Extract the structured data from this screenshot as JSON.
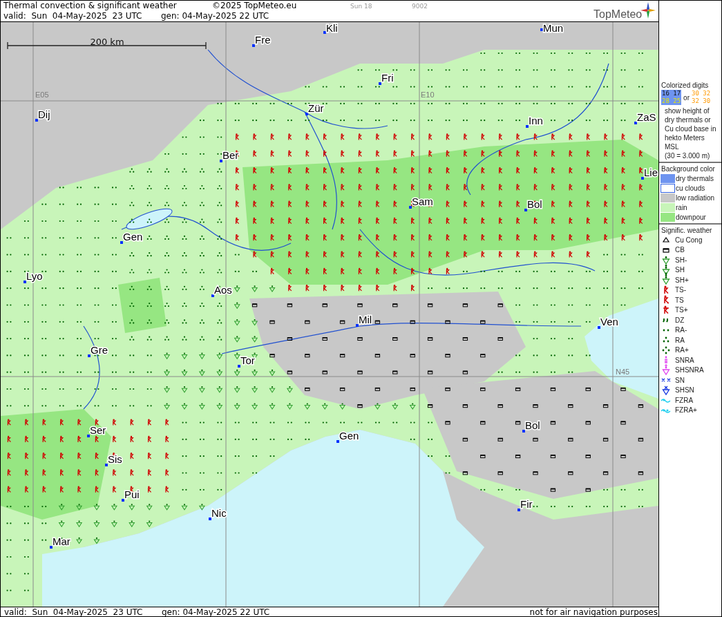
{
  "header": {
    "title": "Thermal convection & significant weather",
    "copyright": "©2025 TopMeteo.eu",
    "run": "Sun 18",
    "code": "9002",
    "valid": "valid:  Sun  04-May-2025  23 UTC",
    "generated": "gen: 04-May-2025 22 UTC",
    "logo": "TopMeteo"
  },
  "map": {
    "scale": "200 km",
    "grid_labels": [
      "E05",
      "E10",
      "N45"
    ],
    "cities": [
      "Kli",
      "Mun",
      "Fre",
      "Fri",
      "Dij",
      "Zür",
      "Inn",
      "ZaS",
      "Ber",
      "Lie",
      "Sam",
      "Bol",
      "Gen",
      "Lyo",
      "Aos",
      "Mil",
      "Ven",
      "Gre",
      "Tor",
      "Ser",
      "Gen",
      "Bol",
      "Sis",
      "Pui",
      "Fir",
      "Nic",
      "Mar"
    ]
  },
  "legend": {
    "digits_title": "Colorized digits",
    "dry_sample": {
      "top": "16 17",
      "bottom": "28 25"
    },
    "or": "or",
    "cu_sample": {
      "top": "30 32",
      "bottom": "32 30"
    },
    "note": "show height of dry thermals or Cu cloud base in hekto Meters MSL",
    "example": "(30 = 3.000 m)",
    "background_title": "Background color",
    "background": [
      {
        "label": "dry thermals",
        "color": "#6e94f0"
      },
      {
        "label": "cu clouds",
        "color": "#ffffff"
      },
      {
        "label": "low radiation",
        "color": "#c8c8c8"
      },
      {
        "label": "rain",
        "color": "#c8f5b9"
      },
      {
        "label": "downpour",
        "color": "#96e682"
      }
    ],
    "weather_title": "Signific. weather",
    "weather": [
      {
        "label": "Cu Cong",
        "kind": "cu_cong"
      },
      {
        "label": "CB",
        "kind": "cb"
      },
      {
        "label": "SH-",
        "kind": "sh_light"
      },
      {
        "label": "SH",
        "kind": "sh"
      },
      {
        "label": "SH+",
        "kind": "sh_heavy"
      },
      {
        "label": "TS-",
        "kind": "ts_light"
      },
      {
        "label": "TS",
        "kind": "ts"
      },
      {
        "label": "TS+",
        "kind": "ts_heavy"
      },
      {
        "label": "DZ",
        "kind": "dz"
      },
      {
        "label": "RA-",
        "kind": "ra_light"
      },
      {
        "label": "RA",
        "kind": "ra"
      },
      {
        "label": "RA+",
        "kind": "ra_heavy"
      },
      {
        "label": "SNRA",
        "kind": "snra"
      },
      {
        "label": "SHSNRA",
        "kind": "shsnra"
      },
      {
        "label": "SN",
        "kind": "sn"
      },
      {
        "label": "SHSN",
        "kind": "shsn"
      },
      {
        "label": "FZRA",
        "kind": "fzra"
      },
      {
        "label": "FZRA+",
        "kind": "fzra_heavy"
      }
    ]
  },
  "footer": {
    "valid": "valid:  Sun  04-May-2025  23 UTC",
    "generated": "gen: 04-May-2025 22 UTC",
    "disclaimer": "not for air navigation purposes"
  }
}
